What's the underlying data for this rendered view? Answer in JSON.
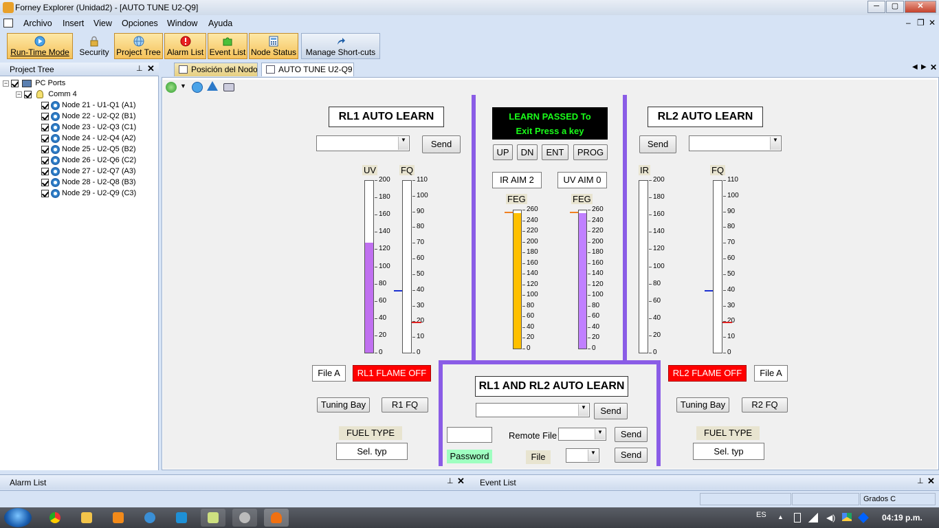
{
  "window": {
    "title": "Forney Explorer (Unidad2) - [AUTO TUNE U2-Q9]",
    "controls": {
      "minimize": "─",
      "maximize": "▢",
      "close": "✕"
    }
  },
  "menu": {
    "items": [
      "Archivo",
      "Insert",
      "View",
      "Opciones",
      "Window",
      "Ayuda"
    ],
    "mdi_controls": {
      "minimize": "–",
      "restore": "❐",
      "close": "✕"
    }
  },
  "toolbar": {
    "buttons": [
      {
        "label": "Run-Time Mode",
        "icon": "play-icon",
        "active": true
      },
      {
        "label": "Security",
        "icon": "lock-icon",
        "active": false
      },
      {
        "label": "Project Tree",
        "icon": "globe-icon",
        "active": true
      },
      {
        "label": "Alarm List",
        "icon": "alarm-icon",
        "active": true
      },
      {
        "label": "Event List",
        "icon": "puzzle-icon",
        "active": true
      },
      {
        "label": "Node Status",
        "icon": "calculator-icon",
        "active": true
      },
      {
        "label": "Manage Short-cuts",
        "icon": "shortcut-arrow-icon",
        "active": false
      }
    ]
  },
  "project_tree": {
    "header": "Project Tree",
    "root": "PC Ports",
    "comm": "Comm 4",
    "nodes": [
      "Node 21 - U1-Q1 (A1)",
      "Node 22 - U2-Q2 (B1)",
      "Node 23 - U2-Q3 (C1)",
      "Node 24 - U2-Q4 (A2)",
      "Node 25 - U2-Q5 (B2)",
      "Node 26 - U2-Q6 (C2)",
      "Node 27 - U2-Q7 (A3)",
      "Node 28 - U2-Q8 (B3)",
      "Node 29 - U2-Q9 (C3)"
    ]
  },
  "tabs": [
    {
      "label": "Posición del Nodo",
      "active": false
    },
    {
      "label": "AUTO TUNE U2-Q9",
      "active": true
    }
  ],
  "rl1": {
    "title": "RL1 AUTO LEARN",
    "send": "Send",
    "uv_label": "UV",
    "fq_label": "FQ",
    "uv_ticks": [
      "200",
      "180",
      "160",
      "140",
      "120",
      "100",
      "80",
      "60",
      "40",
      "20",
      "0"
    ],
    "fq_ticks": [
      "110",
      "100",
      "90",
      "80",
      "70",
      "60",
      "50",
      "40",
      "30",
      "20",
      "10",
      "0"
    ],
    "uv_value_fraction": 0.64,
    "fq_marker_40": "40",
    "fq_marker_20": "20",
    "file": "File A",
    "flame": "RL1 FLAME OFF",
    "tuning": "Tuning Bay",
    "fq_btn": "R1 FQ",
    "fuel_type": "FUEL TYPE",
    "sel": "Sel. typ"
  },
  "rl2": {
    "title": "RL2 AUTO LEARN",
    "send": "Send",
    "ir_label": "IR",
    "fq_label": "FQ",
    "ir_ticks": [
      "200",
      "180",
      "160",
      "140",
      "120",
      "100",
      "80",
      "60",
      "40",
      "20",
      "0"
    ],
    "fq_ticks": [
      "110",
      "100",
      "90",
      "80",
      "70",
      "60",
      "50",
      "40",
      "30",
      "20",
      "10",
      "0"
    ],
    "file": "File A",
    "flame": "RL2 FLAME OFF",
    "tuning": "Tuning Bay",
    "fq_btn": "R2 FQ",
    "fuel_type": "FUEL TYPE",
    "sel": "Sel. typ"
  },
  "center": {
    "lcd_line1": "LEARN PASSED To",
    "lcd_line2": "Exit Press a key",
    "keys": [
      "UP",
      "DN",
      "ENT",
      "PROG"
    ],
    "ir_aim": "IR AIM 2",
    "uv_aim": "UV AIM 0",
    "feg1": "FEG",
    "feg2": "FEG",
    "feg_ticks": [
      "260",
      "240",
      "220",
      "200",
      "180",
      "160",
      "140",
      "120",
      "100",
      "80",
      "60",
      "40",
      "20",
      "0"
    ],
    "feg1_value": 255,
    "feg2_value": 255,
    "feg_max": 260,
    "feg1_color": "#ffc000",
    "feg2_color": "#c080ff"
  },
  "combined": {
    "title": "RL1 AND RL2 AUTO LEARN",
    "send1": "Send",
    "remote_file": "Remote File",
    "send2": "Send",
    "password": "Password",
    "file": "File",
    "send3": "Send"
  },
  "bottom": {
    "alarm_list": "Alarm List",
    "event_list": "Event List",
    "units": "Grados C"
  },
  "taskbar": {
    "lang": "ES",
    "time": "04:19 p.m."
  },
  "colors": {
    "uv_fill": "#c070f0",
    "divider": "#8a5ce6",
    "flame_off": "#ff0000",
    "lcd_text": "#19ff19",
    "password_bg": "#9effc0"
  }
}
